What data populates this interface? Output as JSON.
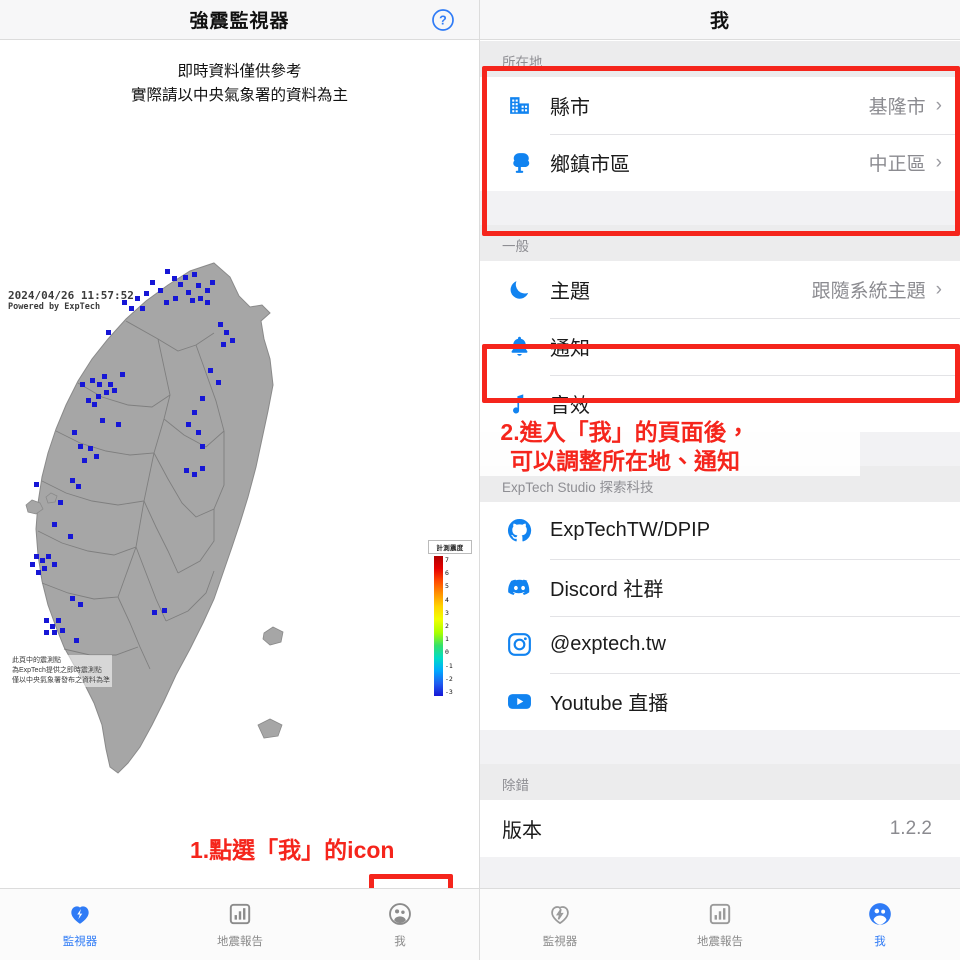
{
  "left": {
    "header": {
      "title": "強震監視器",
      "help_icon": "help-circle-icon"
    },
    "disclaimer_line1": "即時資料僅供參考",
    "disclaimer_line2": "實際請以中央氣象署的資料為主",
    "map": {
      "timestamp": "2024/04/26 11:57:52",
      "powered_by": "Powered by ExpTech",
      "note_line1": "此頁中的震測點",
      "note_line2": "為ExpTech提供之即時震測點",
      "note_line3": "僅以中央氣象署發布之資料為準",
      "legend_title": "計測震度",
      "legend_labels": [
        "7",
        "6",
        "5",
        "4",
        "3",
        "2",
        "1",
        "0",
        "-1",
        "-2",
        "-3"
      ],
      "station_color": "#1616d6",
      "land_color": "#a6a6a6"
    },
    "tabs": [
      {
        "label": "監視器",
        "icon": "heart-pulse-icon",
        "active": true
      },
      {
        "label": "地震報告",
        "icon": "bar-chart-icon",
        "active": false
      },
      {
        "label": "我",
        "icon": "people-icon",
        "active": false
      }
    ],
    "annotation": {
      "text": "1.點選「我」的icon",
      "color": "#f5251c"
    }
  },
  "right": {
    "header": {
      "title": "我"
    },
    "sections": [
      {
        "title": "所在地",
        "rows": [
          {
            "icon": "building-icon",
            "label": "縣市",
            "value": "基隆市",
            "chevron": "›"
          },
          {
            "icon": "tree-icon",
            "label": "鄉鎮市區",
            "value": "中正區",
            "chevron": "›"
          }
        ]
      },
      {
        "title": "一般",
        "rows": [
          {
            "icon": "moon-icon",
            "label": "主題",
            "value": "跟隨系統主題",
            "chevron": "›"
          },
          {
            "icon": "bell-icon",
            "label": "通知",
            "value": "",
            "chevron": ""
          },
          {
            "icon": "music-note-icon",
            "label": "音效",
            "value": "",
            "chevron": ""
          }
        ]
      },
      {
        "title": "ExpTech Studio 探索科技",
        "rows": [
          {
            "icon": "github-icon",
            "label": "ExpTechTW/DPIP",
            "value": "",
            "chevron": ""
          },
          {
            "icon": "discord-icon",
            "label": "Discord 社群",
            "value": "",
            "chevron": ""
          },
          {
            "icon": "instagram-icon",
            "label": "@exptech.tw",
            "value": "",
            "chevron": ""
          },
          {
            "icon": "youtube-icon",
            "label": "Youtube 直播",
            "value": "",
            "chevron": ""
          }
        ]
      },
      {
        "title": "除錯",
        "rows": [
          {
            "icon": "",
            "label": "版本",
            "value": "1.2.2",
            "chevron": ""
          }
        ]
      }
    ],
    "tabs": [
      {
        "label": "監視器",
        "icon": "heart-pulse-icon",
        "active": false
      },
      {
        "label": "地震報告",
        "icon": "bar-chart-icon",
        "active": false
      },
      {
        "label": "我",
        "icon": "people-icon",
        "active": true
      }
    ],
    "annotation": {
      "line1": "2.進入「我」的頁面後，",
      "line2": "可以調整所在地、通知",
      "color": "#f5251c"
    }
  },
  "colors": {
    "accent": "#2f7bf6",
    "annotation_red": "#f5251c",
    "muted": "#8e8e93"
  }
}
